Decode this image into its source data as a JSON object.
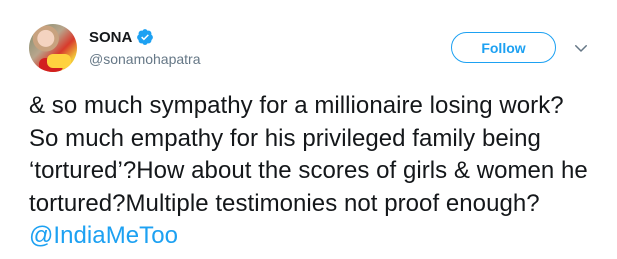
{
  "author": {
    "name": "SONA",
    "handle": "@sonamohapatra",
    "verified_icon": "verified-badge-icon"
  },
  "actions": {
    "follow_label": "Follow",
    "menu_icon": "chevron-down-icon"
  },
  "tweet": {
    "text": "& so much sympathy for a millionaire losing work? So much empathy for his privileged family being ‘tortured’?How about the scores of girls & women he tortured?Multiple testimonies not proof enough?",
    "hashtag": "@IndiaMeToo"
  },
  "colors": {
    "accent": "#1da1f2",
    "text": "#14171a",
    "secondary_text": "#657786"
  }
}
